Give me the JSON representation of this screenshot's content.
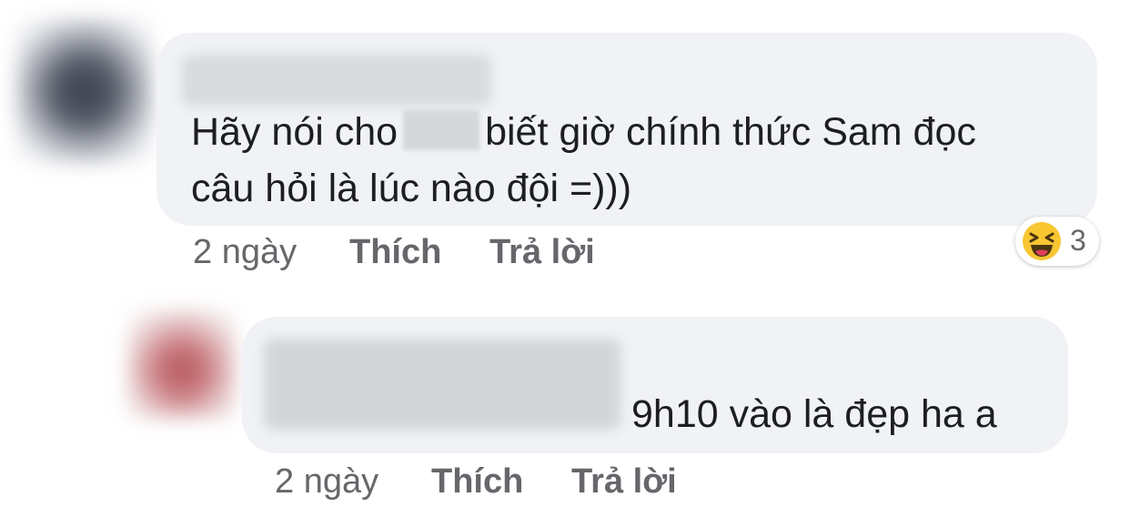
{
  "comments": [
    {
      "line1_before": "Hãy nói cho",
      "line1_after": "biết giờ chính thức Sam đọc",
      "line2": "câu hỏi là lúc nào đội =)))",
      "time": "2 ngày",
      "like_label": "Thích",
      "reply_label": "Trả lời",
      "reaction": {
        "icon": "laughing-emoji-icon",
        "count": "3",
        "emoji_color": "#f7c631"
      }
    },
    {
      "text": "9h10 vào là đẹp ha a",
      "time": "2 ngày",
      "like_label": "Thích",
      "reply_label": "Trả lời"
    }
  ],
  "colors": {
    "bubble": "#f0f2f5",
    "text": "#1c1e21",
    "meta": "#65676b"
  }
}
